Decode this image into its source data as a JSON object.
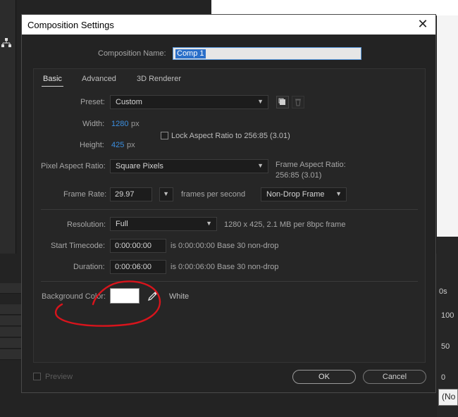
{
  "dialog": {
    "title": "Composition Settings",
    "close_glyph": "✕",
    "comp_name_label": "Composition Name:",
    "comp_name_value": "Comp 1",
    "tabs": [
      "Basic",
      "Advanced",
      "3D Renderer"
    ],
    "active_tab": "Basic",
    "preset": {
      "label": "Preset:",
      "value": "Custom"
    },
    "width": {
      "label": "Width:",
      "value": "1280",
      "unit": "px"
    },
    "height": {
      "label": "Height:",
      "value": "425",
      "unit": "px"
    },
    "lock_aspect": {
      "label": "Lock Aspect Ratio to 256:85 (3.01)",
      "checked": false
    },
    "pixel_aspect": {
      "label": "Pixel Aspect Ratio:",
      "value": "Square Pixels"
    },
    "frame_aspect": {
      "label": "Frame Aspect Ratio:",
      "value": "256:85 (3.01)"
    },
    "frame_rate": {
      "label": "Frame Rate:",
      "value": "29.97",
      "unit": "frames per second",
      "drop": "Non-Drop Frame"
    },
    "resolution": {
      "label": "Resolution:",
      "value": "Full",
      "info": "1280 x 425, 2.1 MB per 8bpc frame"
    },
    "start_timecode": {
      "label": "Start Timecode:",
      "value": "0:00:00:00",
      "info": "is 0:00:00:00  Base 30  non-drop"
    },
    "duration": {
      "label": "Duration:",
      "value": "0:00:06:00",
      "info": "is 0:00:06:00  Base 30  non-drop"
    },
    "background": {
      "label": "Background Color:",
      "color": "#ffffff",
      "name": "White"
    },
    "preview_label": "Preview",
    "ok_label": "OK",
    "cancel_label": "Cancel"
  },
  "background_app": {
    "right_labels": [
      "0s",
      "100",
      "50",
      "0"
    ],
    "tooltip": "(No"
  },
  "colors": {
    "accent_blue": "#3b8fe0",
    "selection": "#2a6fc9",
    "annotation_red": "#d8141c"
  }
}
